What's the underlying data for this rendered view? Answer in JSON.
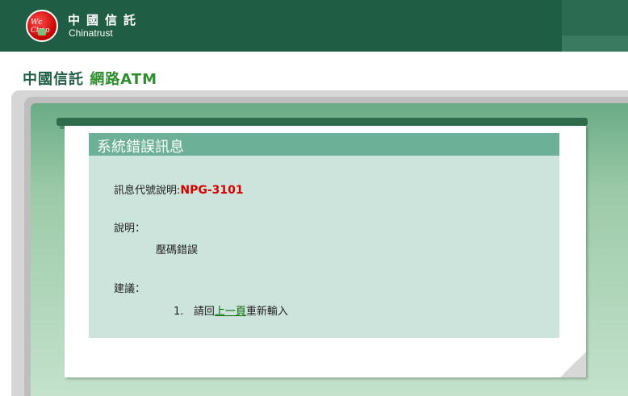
{
  "header": {
    "logo_text": "Wc Ctrip",
    "brand_cn": "中國信託",
    "brand_en": "Chinatrust"
  },
  "page_title": {
    "prefix": "中國信託",
    "highlight": "網路ATM"
  },
  "message": {
    "title": "系統錯誤訊息",
    "code_label": "訊息代號說明:",
    "code_value": "NPG-3101",
    "desc_label": "說明：",
    "desc_text": "壓碼錯誤",
    "suggest_label": "建議：",
    "suggest_number": "1.",
    "suggest_pre": "請回",
    "suggest_link": "上一頁",
    "suggest_post": "重新輸入"
  },
  "colors": {
    "header_bg": "#1f5e45",
    "title_green": "#2f8f2f",
    "msg_title_bg": "#6bb097",
    "msg_body_bg": "#cde4dc",
    "error_code": "#d40000"
  }
}
